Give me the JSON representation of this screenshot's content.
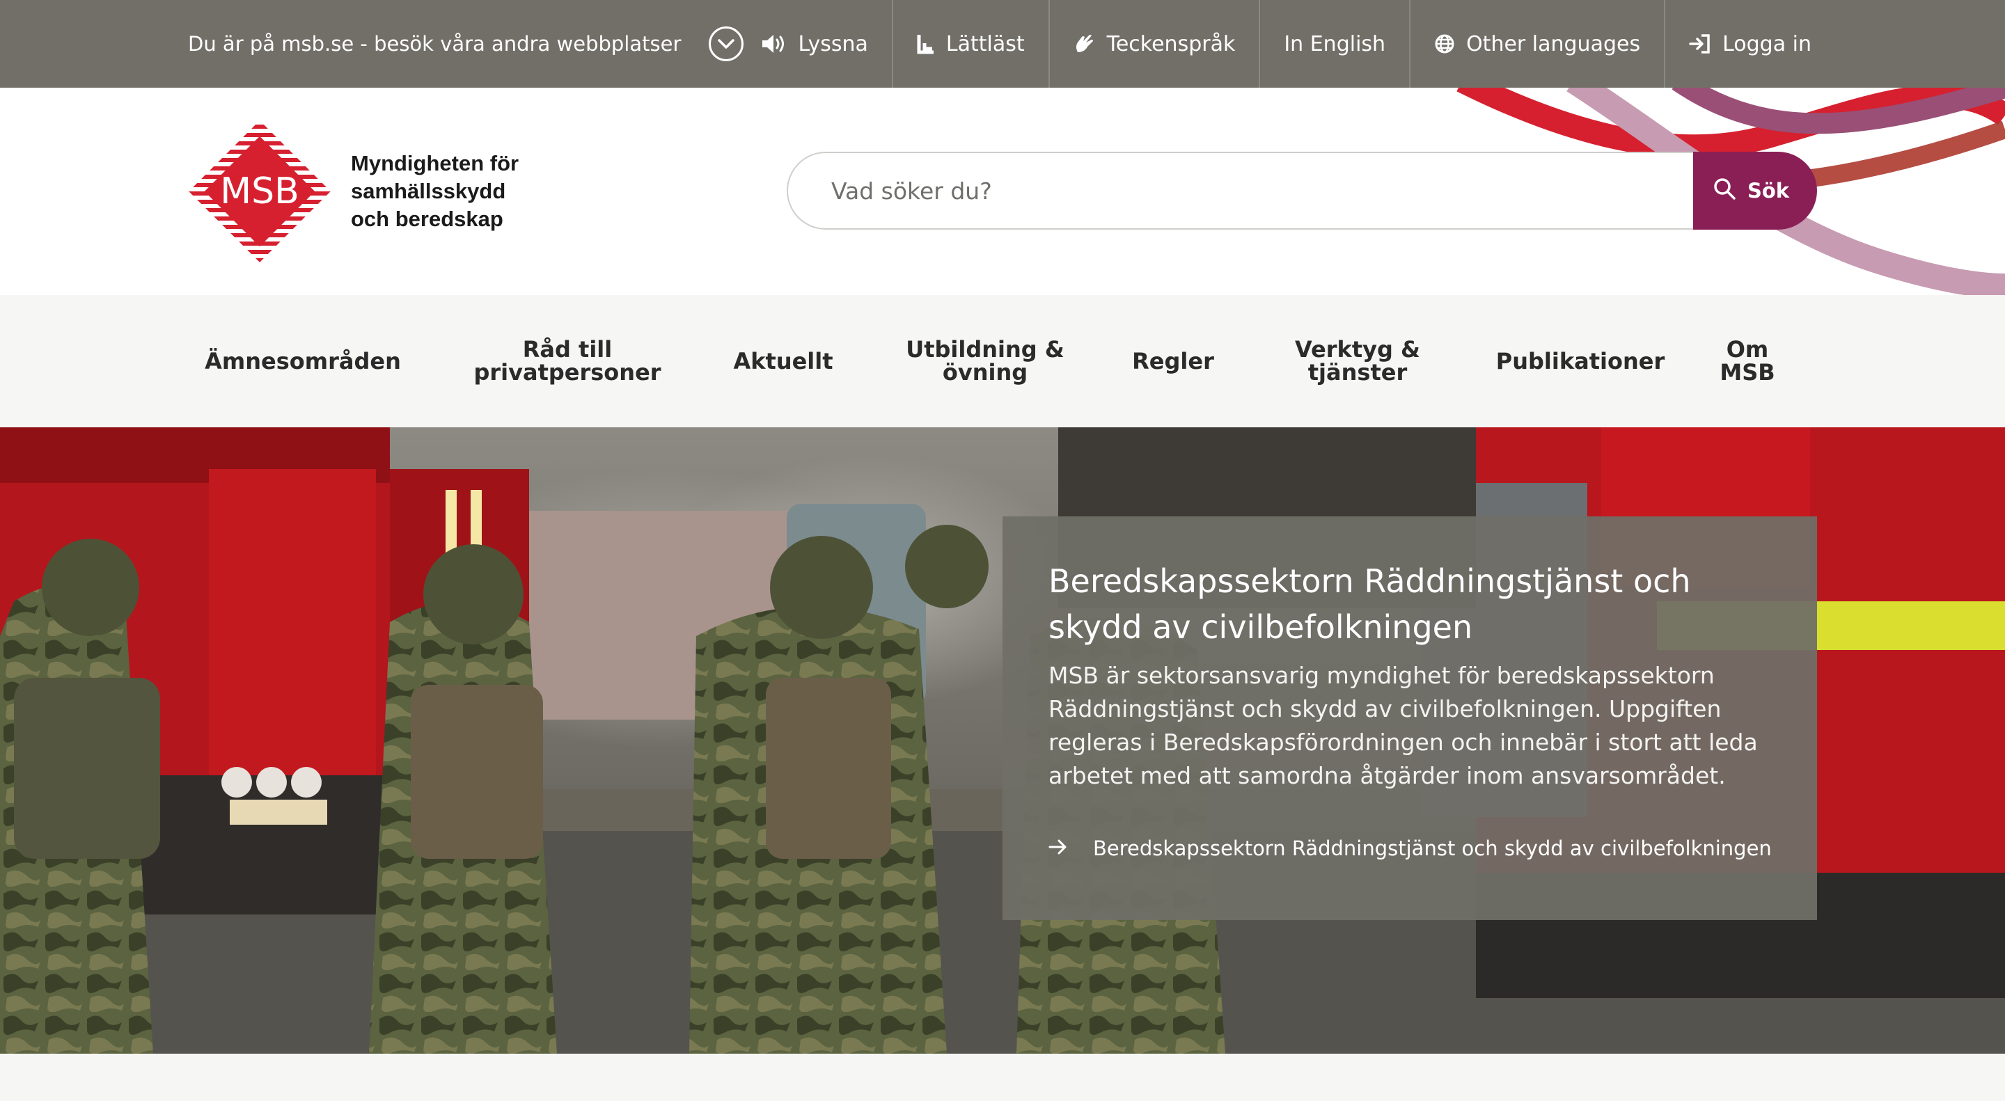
{
  "topbar": {
    "site_notice": "Du är på msb.se - besök våra andra webbplatser",
    "links": [
      {
        "label": "Lyssna",
        "icon": "speaker-icon"
      },
      {
        "label": "Lättläst",
        "icon": "easy-read-icon"
      },
      {
        "label": "Teckenspråk",
        "icon": "sign-language-icon"
      },
      {
        "label": "In English",
        "icon": ""
      },
      {
        "label": "Other languages",
        "icon": "globe-icon"
      },
      {
        "label": "Logga in",
        "icon": "login-icon"
      }
    ]
  },
  "header": {
    "logo_mark": "MSB",
    "logo_lines": [
      "Myndigheten för",
      "samhällsskydd",
      "och beredskap"
    ],
    "search_placeholder": "Vad söker du?",
    "search_button": "Sök"
  },
  "nav": {
    "items": [
      {
        "lines": [
          "Ämnesområden"
        ]
      },
      {
        "lines": [
          "Råd till",
          "privatpersoner"
        ]
      },
      {
        "lines": [
          "Aktuellt"
        ]
      },
      {
        "lines": [
          "Utbildning &",
          "övning"
        ]
      },
      {
        "lines": [
          "Regler"
        ]
      },
      {
        "lines": [
          "Verktyg &",
          "tjänster"
        ]
      },
      {
        "lines": [
          "Publikationer"
        ]
      },
      {
        "lines": [
          "Om",
          "MSB"
        ]
      }
    ]
  },
  "hero": {
    "title": "Beredskapssektorn Räddningstjänst och skydd av civilbefolkningen",
    "text": "MSB är sektorsansvarig myndighet för beredskapssektorn Räddningstjänst och skydd av civilbefolkningen. Uppgiften regleras i Beredskapsförordningen och innebär i stort att leda arbetet med att samordna åtgärder inom ansvarsområdet.",
    "link": "Beredskapssektorn Räddningstjänst och skydd av civilbefolkningen"
  },
  "colors": {
    "topbar": "#716f68",
    "brand_red": "#d6202f",
    "search_button": "#8a1f56",
    "hero_card": "#706e67"
  }
}
